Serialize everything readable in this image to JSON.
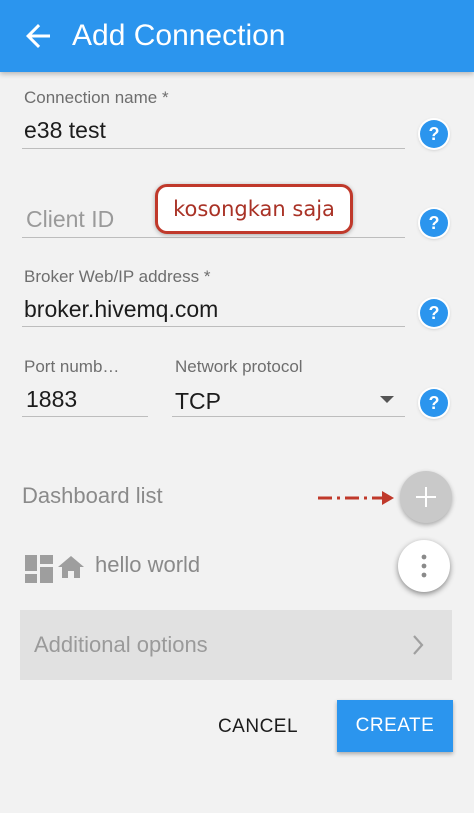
{
  "appbar": {
    "title": "Add Connection",
    "back_icon": "arrow-back-icon"
  },
  "form": {
    "connection_name": {
      "label": "Connection name",
      "required_mark": "*",
      "value": "e38 test"
    },
    "client_id": {
      "placeholder": "Client ID",
      "value": ""
    },
    "broker": {
      "label": "Broker Web/IP address",
      "required_mark": "*",
      "value": "broker.hivemq.com"
    },
    "port": {
      "label": "Port numb…",
      "value": "1883"
    },
    "protocol": {
      "label": "Network protocol",
      "value": "TCP"
    },
    "help_icon": "?"
  },
  "annotation": {
    "text": "kosongkan saja",
    "color": "#c0392b"
  },
  "dashboard": {
    "title": "Dashboard list",
    "add_icon": "plus-icon",
    "items": [
      {
        "label": "hello world",
        "icons": [
          "dashboard-icon",
          "home-icon"
        ]
      }
    ]
  },
  "options": {
    "label": "Additional options"
  },
  "actions": {
    "cancel": "CANCEL",
    "create": "CREATE"
  },
  "colors": {
    "accent": "#2b95ee",
    "arrow": "#c0392b"
  }
}
